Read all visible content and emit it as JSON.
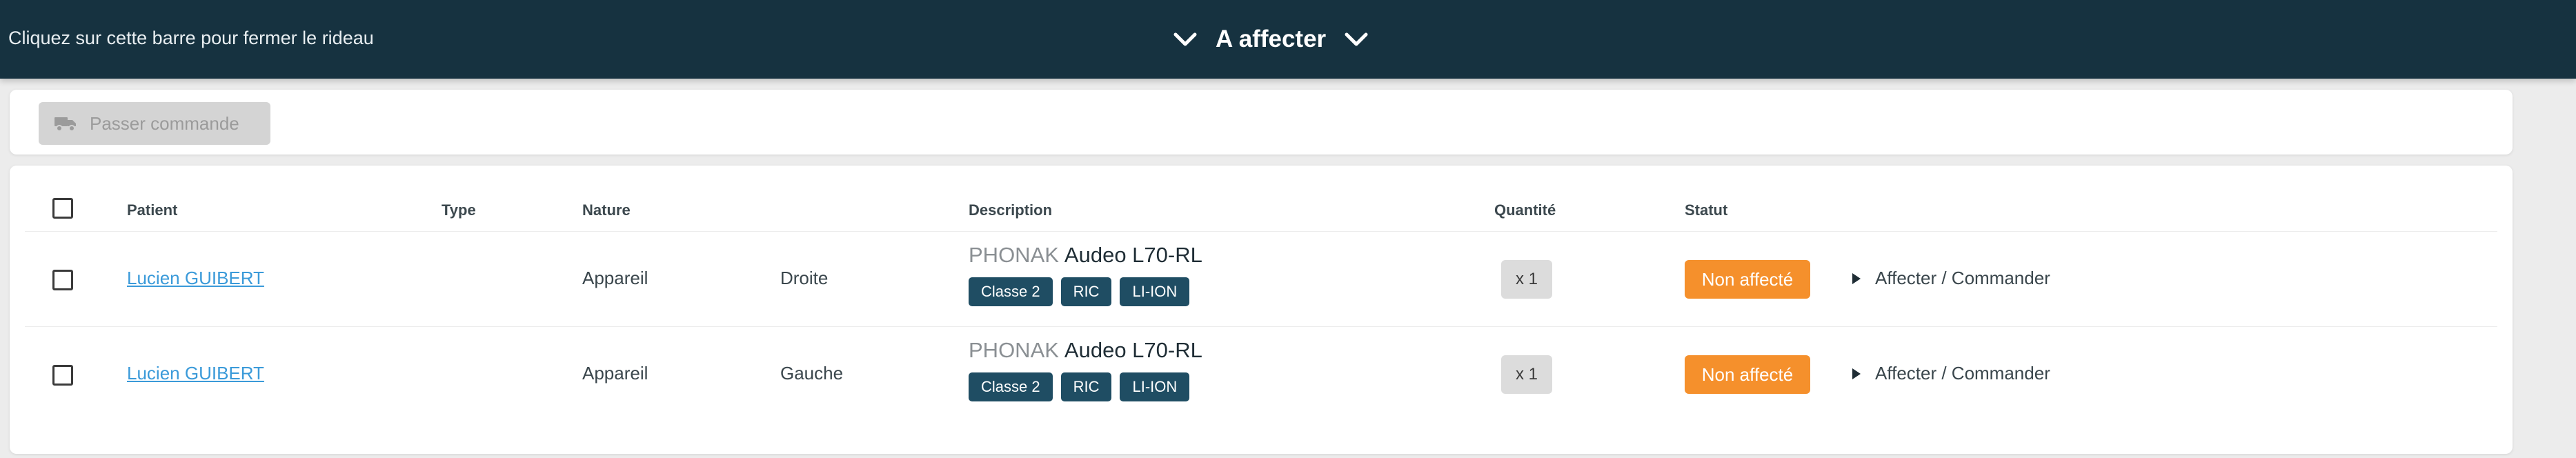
{
  "topbar": {
    "hint": "Cliquez sur cette barre pour fermer le rideau",
    "title": "A affecter"
  },
  "toolbar": {
    "order_label": "Passer commande"
  },
  "table": {
    "headers": {
      "patient": "Patient",
      "type": "Type",
      "nature": "Nature",
      "description": "Description",
      "quantity": "Quantité",
      "status": "Statut"
    },
    "rows": [
      {
        "patient": "Lucien GUIBERT",
        "nature": "Appareil",
        "side": "Droite",
        "brand": "PHONAK",
        "model": "Audeo L70-RL",
        "tags": [
          "Classe 2",
          "RIC",
          "LI-ION"
        ],
        "quantity": "x 1",
        "status": "Non affecté",
        "action": "Affecter / Commander"
      },
      {
        "patient": "Lucien GUIBERT",
        "nature": "Appareil",
        "side": "Gauche",
        "brand": "PHONAK",
        "model": "Audeo L70-RL",
        "tags": [
          "Classe 2",
          "RIC",
          "LI-ION"
        ],
        "quantity": "x 1",
        "status": "Non affecté",
        "action": "Affecter / Commander"
      }
    ]
  },
  "colors": {
    "topbar": "#163240",
    "tag": "#1f4d63",
    "status_unassigned": "#f5902c",
    "link": "#3a9ad9"
  },
  "icons": [
    "chevron-down-icon",
    "truck-icon",
    "play-icon",
    "checkbox"
  ]
}
